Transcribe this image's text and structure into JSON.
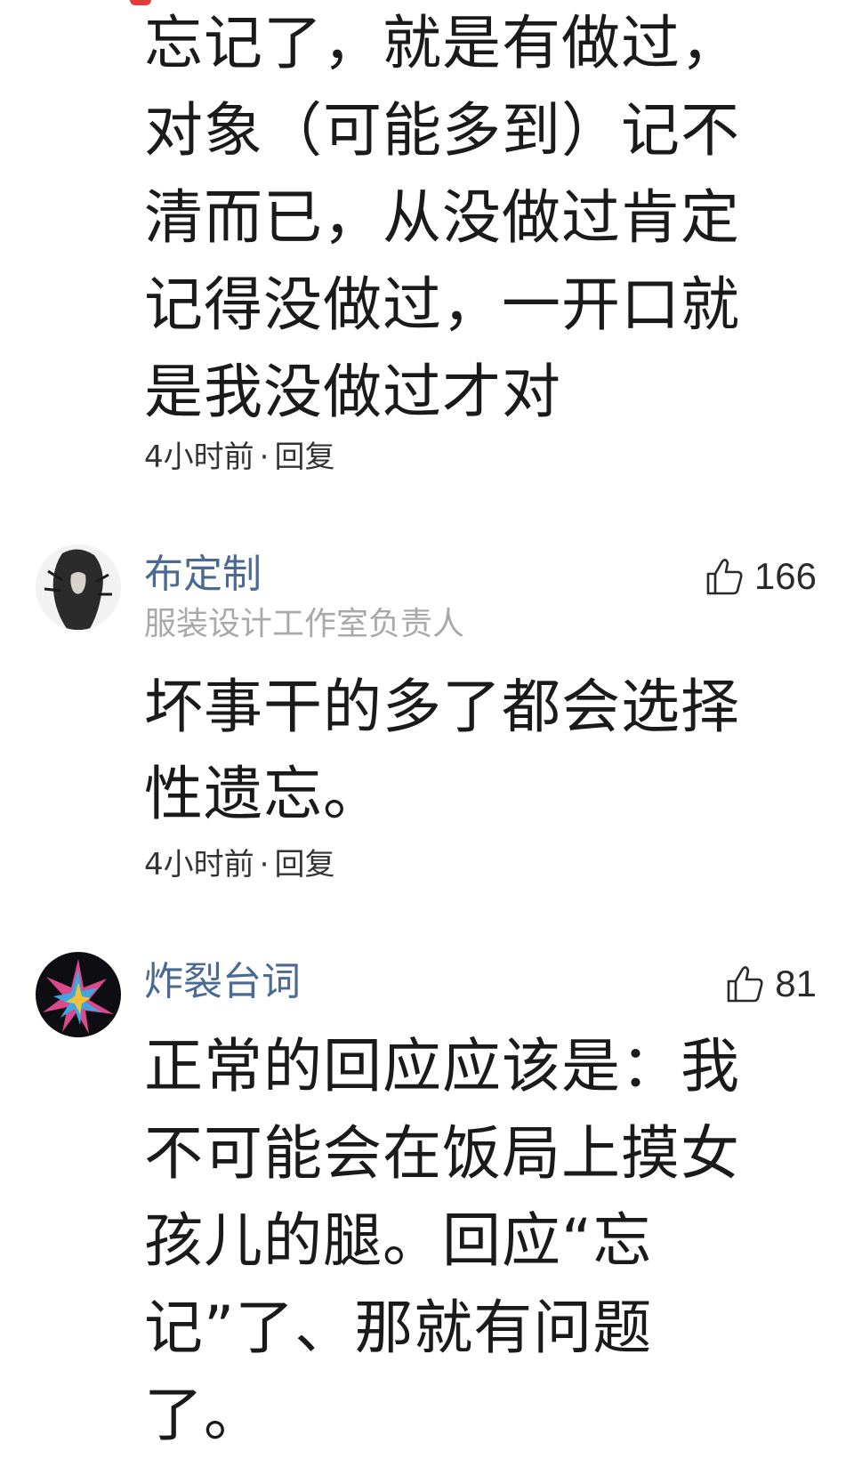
{
  "comments": [
    {
      "text": "忘记了，就是有做过，\n对象（可能多到）记不\n清而已，从没做过肯定\n记得没做过，一开口就\n是我没做过才对",
      "time": "4小时前",
      "reply": "回复"
    },
    {
      "user": "布定制",
      "subtitle": "服装设计工作室负责人",
      "likes": "166",
      "text": "坏事干的多了都会选择\n性遗忘。",
      "time": "4小时前",
      "reply": "回复"
    },
    {
      "user": "炸裂台词",
      "likes": "81",
      "text": "正常的回应应该是：我\n不可能会在饭局上摸女\n孩儿的腿。回应“忘\n记”了、那就有问题了。"
    }
  ],
  "colors": {
    "username": "#4a6a93",
    "subtitle": "#a9a9a9",
    "body": "#1a1a1a"
  },
  "icons": {
    "like": "thumbs-up-icon"
  }
}
